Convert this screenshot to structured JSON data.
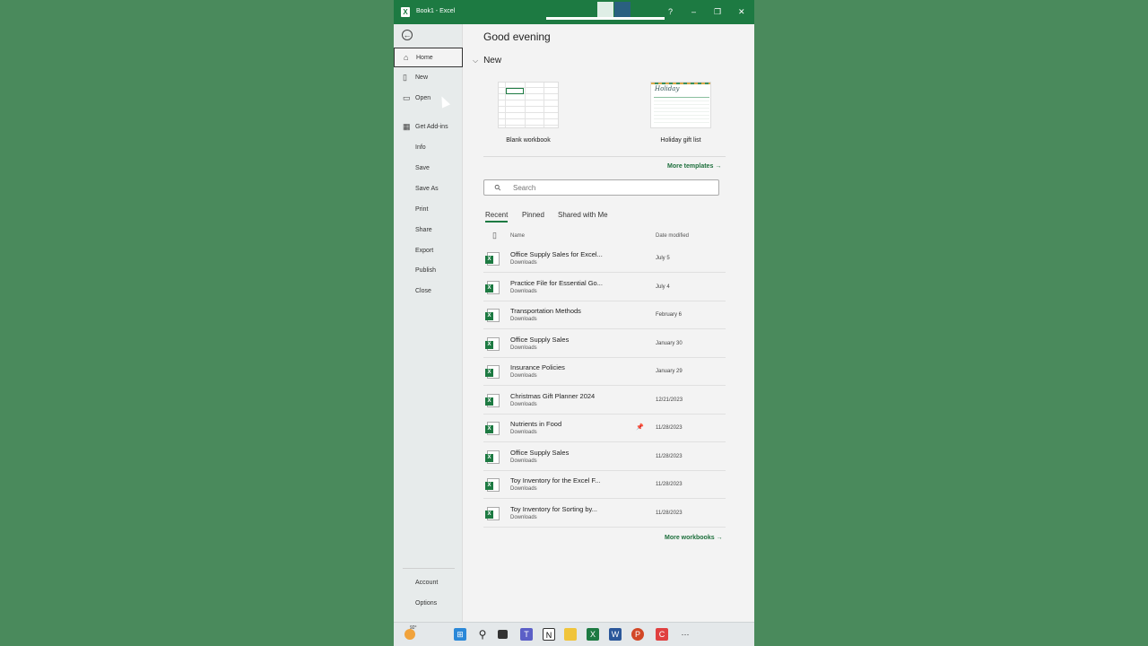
{
  "window": {
    "title": "Book1  -  Excel",
    "help": "?",
    "minimize": "–",
    "restore": "❐",
    "close": "✕"
  },
  "sidebar": {
    "back": "←",
    "items": [
      {
        "label": "Home",
        "icon": "home-icon"
      },
      {
        "label": "New",
        "icon": "new-doc-icon"
      },
      {
        "label": "Open",
        "icon": "folder-icon"
      },
      {
        "label": "Get Add-ins",
        "icon": "grid-icon"
      },
      {
        "label": "Info"
      },
      {
        "label": "Save"
      },
      {
        "label": "Save As"
      },
      {
        "label": "Print"
      },
      {
        "label": "Share"
      },
      {
        "label": "Export"
      },
      {
        "label": "Publish"
      },
      {
        "label": "Close"
      }
    ],
    "bottom": [
      {
        "label": "Account"
      },
      {
        "label": "Options"
      }
    ]
  },
  "main": {
    "greeting": "Good evening",
    "new_section": "New",
    "templates": [
      {
        "caption": "Blank workbook"
      },
      {
        "caption": "Holiday gift list",
        "thumb_title": "Holiday"
      }
    ],
    "more_templates": "More templates",
    "search": {
      "placeholder": "Search"
    },
    "tabs": [
      "Recent",
      "Pinned",
      "Shared with Me"
    ],
    "columns": {
      "name": "Name",
      "date": "Date modified"
    },
    "files": [
      {
        "name": "Office Supply Sales for Excel...",
        "location": "Downloads",
        "date": "July 5"
      },
      {
        "name": "Practice File for Essential Go...",
        "location": "Downloads",
        "date": "July 4"
      },
      {
        "name": "Transportation Methods",
        "location": "Downloads",
        "date": "February 6"
      },
      {
        "name": "Office Supply Sales",
        "location": "Downloads",
        "date": "January 30"
      },
      {
        "name": "Insurance Policies",
        "location": "Downloads",
        "date": "January 29"
      },
      {
        "name": "Christmas Gift Planner 2024",
        "location": "Downloads",
        "date": "12/21/2023"
      },
      {
        "name": "Nutrients in Food",
        "location": "Downloads",
        "date": "11/28/2023",
        "pinned": true
      },
      {
        "name": "Office Supply Sales",
        "location": "Downloads",
        "date": "11/28/2023"
      },
      {
        "name": "Toy Inventory for the Excel F...",
        "location": "Downloads",
        "date": "11/28/2023"
      },
      {
        "name": "Toy Inventory for Sorting by...",
        "location": "Downloads",
        "date": "11/28/2023"
      }
    ],
    "more_workbooks": "More workbooks"
  },
  "taskbar": {
    "weather_temp": "92°",
    "icons": [
      "windows-start-icon",
      "search-icon",
      "task-view-icon",
      "teams-icon",
      "notion-icon",
      "file-explorer-icon",
      "excel-icon",
      "word-icon",
      "powerpoint-icon",
      "screen-recorder-icon",
      "more-icon"
    ]
  },
  "colors": {
    "accent": "#1d7a42",
    "background": "#4a8a5c"
  }
}
